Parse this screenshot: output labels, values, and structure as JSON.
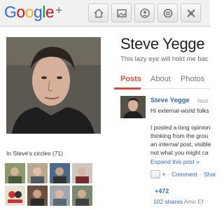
{
  "header": {
    "logo_text": "Google",
    "logo_plus": "+",
    "nav_icons": [
      "home-icon",
      "photos-icon",
      "profile-icon",
      "circles-icon",
      "games-icon"
    ]
  },
  "profile": {
    "name": "Steve Yegge",
    "tagline": "This lazy eye will hold me bac",
    "circles_label": "In Steve's circles (71)"
  },
  "tabs": [
    {
      "label": "Posts",
      "active": true
    },
    {
      "label": "About",
      "active": false
    },
    {
      "label": "Photos",
      "active": false
    }
  ],
  "post": {
    "author": "Steve Yegge",
    "timestamp": "Yest",
    "greeting": "Hi external-world folks",
    "line1": "I posted a long opinion",
    "line2": "thinking from the grou",
    "line3_before": "an ",
    "line3_em": "internal",
    "line3_after": " post, visible",
    "line4": "not what you might ca",
    "expand": "Expand this post »",
    "comment": "Comment",
    "share": "Shar",
    "plus_count": "+472",
    "shares": "102 shares",
    "sharers": "- Amir Ef"
  },
  "colors": {
    "accent": "#dd4b39",
    "link": "#3366cc",
    "topbar": "#f1f1f1"
  }
}
